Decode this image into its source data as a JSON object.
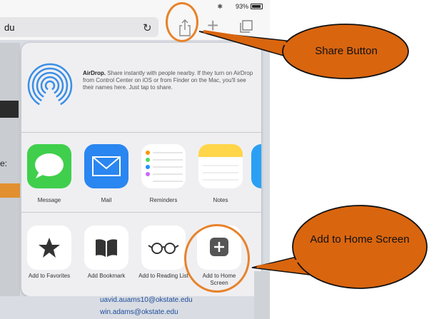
{
  "status_bar": {
    "battery": "93%",
    "bluetooth": "✱"
  },
  "toolbar": {
    "url": "du",
    "reload_icon": "reload-icon",
    "share_icon": "share-icon",
    "new_tab": "+",
    "tabs_icon": "tabs-icon"
  },
  "background": {
    "left_label": "e:"
  },
  "share_sheet": {
    "airdrop": {
      "title": "AirDrop.",
      "body": "Share instantly with people nearby. If they turn on AirDrop from Control Center on iOS or from Finder on the Mac, you'll see their names here. Just tap to share."
    },
    "apps": [
      {
        "label": "Message",
        "icon": "message-icon",
        "color": "#3fcf4c"
      },
      {
        "label": "Mail",
        "icon": "mail-icon",
        "color": "#2a86f0"
      },
      {
        "label": "Reminders",
        "icon": "reminders-icon",
        "color": "#ffffff"
      },
      {
        "label": "Notes",
        "icon": "notes-icon",
        "color": "#ffd54a"
      }
    ],
    "actions": [
      {
        "label": "Add to Favorites",
        "icon": "star-icon"
      },
      {
        "label": "Add Bookmark",
        "icon": "book-icon"
      },
      {
        "label": "Add to Reading List",
        "icon": "glasses-icon"
      },
      {
        "label": "Add to Home Screen",
        "icon": "add-home-icon"
      }
    ]
  },
  "page_bottom": {
    "email_1": "uavid.auams10@okstate.edu",
    "email_2": "win.adams@okstate.edu"
  },
  "callouts": {
    "share": "Share Button",
    "add_home": "Add to Home Screen",
    "accent": "#e8822a",
    "fill": "#d9650f"
  }
}
